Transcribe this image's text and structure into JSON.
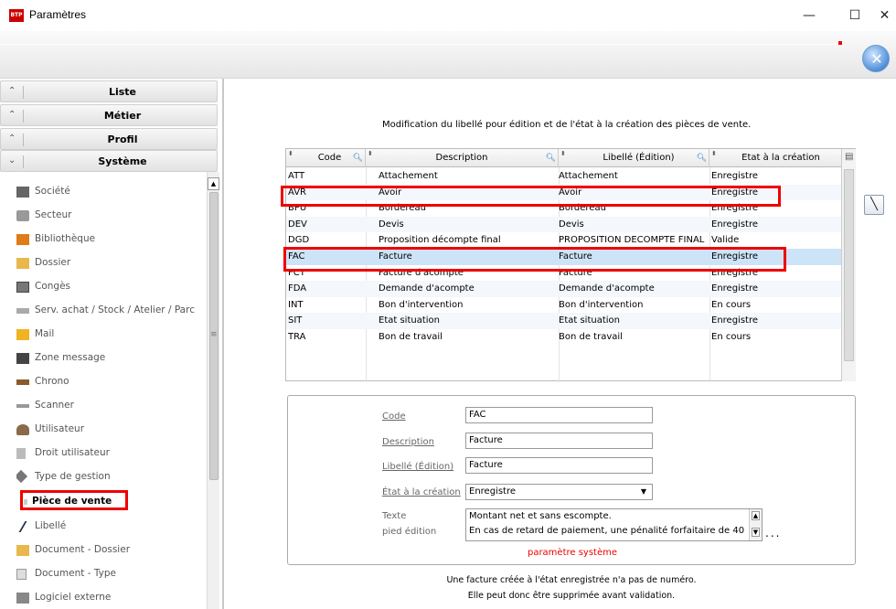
{
  "window": {
    "title": "Paramètres",
    "minimize": "—",
    "maximize": "☐",
    "close": "✕"
  },
  "toolbar": {
    "close_icon": "close-circle-icon"
  },
  "sidebar": {
    "sections": [
      {
        "label": "Liste",
        "chevron": "≈"
      },
      {
        "label": "Métier",
        "chevron": "≈"
      },
      {
        "label": "Profil",
        "chevron": "≈"
      },
      {
        "label": "Système",
        "chevron": "≈"
      }
    ],
    "items": [
      {
        "label": "Société",
        "icon": "building-icon"
      },
      {
        "label": "Secteur",
        "icon": "box-icon"
      },
      {
        "label": "Bibliothèque",
        "icon": "books-icon"
      },
      {
        "label": "Dossier",
        "icon": "folder-icon"
      },
      {
        "label": "Congès",
        "icon": "calendar-icon"
      },
      {
        "label": "Serv. achat / Stock / Atelier / Parc",
        "icon": "truck-icon"
      },
      {
        "label": "Mail",
        "icon": "mail-icon"
      },
      {
        "label": "Zone message",
        "icon": "message-icon"
      },
      {
        "label": "Chrono",
        "icon": "chrono-icon"
      },
      {
        "label": "Scanner",
        "icon": "scanner-icon"
      },
      {
        "label": "Utilisateur",
        "icon": "user-icon"
      },
      {
        "label": "Droit utilisateur",
        "icon": "lock-icon"
      },
      {
        "label": "Type de gestion",
        "icon": "tag-icon"
      },
      {
        "label": "Pièce de vente",
        "icon": "arrow-icon"
      },
      {
        "label": "Libellé",
        "icon": "pen-icon"
      },
      {
        "label": "Document - Dossier",
        "icon": "folder-doc-icon"
      },
      {
        "label": "Document - Type",
        "icon": "doc-icon"
      },
      {
        "label": "Logiciel externe",
        "icon": "software-icon"
      }
    ],
    "selected": "Pièce de vente"
  },
  "main": {
    "heading": "Modification du libellé pour édition et de l'état à la création des pièces de vente.",
    "columns": [
      "Code",
      "Description",
      "Libellé (Édition)",
      "Etat à la création"
    ],
    "rows": [
      {
        "code": "ATT",
        "description": "Attachement",
        "libelle": "Attachement",
        "etat": "Enregistre"
      },
      {
        "code": "AVR",
        "description": "Avoir",
        "libelle": "Avoir",
        "etat": "Enregistre"
      },
      {
        "code": "BPU",
        "description": "Bordereau",
        "libelle": "Bordereau",
        "etat": "Enregistre"
      },
      {
        "code": "DEV",
        "description": "Devis",
        "libelle": "Devis",
        "etat": "Enregistre"
      },
      {
        "code": "DGD",
        "description": "Proposition décompte final",
        "libelle": "PROPOSITION DECOMPTE FINAL",
        "etat": "Valide"
      },
      {
        "code": "FAC",
        "description": "Facture",
        "libelle": "Facture",
        "etat": "Enregistre"
      },
      {
        "code": "FCT",
        "description": "Facture d'acompte",
        "libelle": "Facture",
        "etat": "Enregistre"
      },
      {
        "code": "FDA",
        "description": "Demande d'acompte",
        "libelle": "Demande d'acompte",
        "etat": "Enregistre"
      },
      {
        "code": "INT",
        "description": "Bon d'intervention",
        "libelle": "Bon d'intervention",
        "etat": "En cours"
      },
      {
        "code": "SIT",
        "description": "Etat situation",
        "libelle": "Etat situation",
        "etat": "Enregistre"
      },
      {
        "code": "TRA",
        "description": "Bon de travail",
        "libelle": "Bon de travail",
        "etat": "En cours"
      }
    ],
    "selected_code": "FAC"
  },
  "form": {
    "code_label": "Code",
    "code_value": "FAC",
    "description_label": "Description",
    "description_value": "Facture",
    "libelle_label": "Libellé (Édition)",
    "libelle_value": "Facture",
    "etat_label": "État à la création",
    "etat_value": "Enregistre",
    "texte_label_1": "Texte",
    "texte_label_2": "pied édition",
    "texte_line_1": "Montant net et sans escompte.",
    "texte_line_2": "En cas de retard de paiement, une pénalité forfaitaire de 40",
    "dots": "...",
    "system_note": "paramètre système"
  },
  "notes": {
    "line1": "Une facture créée à l'état enregistrée n'a pas de numéro.",
    "line2": "Elle peut donc être supprimée avant validation."
  },
  "colors": {
    "accent": "#e00000",
    "selection": "#cde3f7"
  }
}
